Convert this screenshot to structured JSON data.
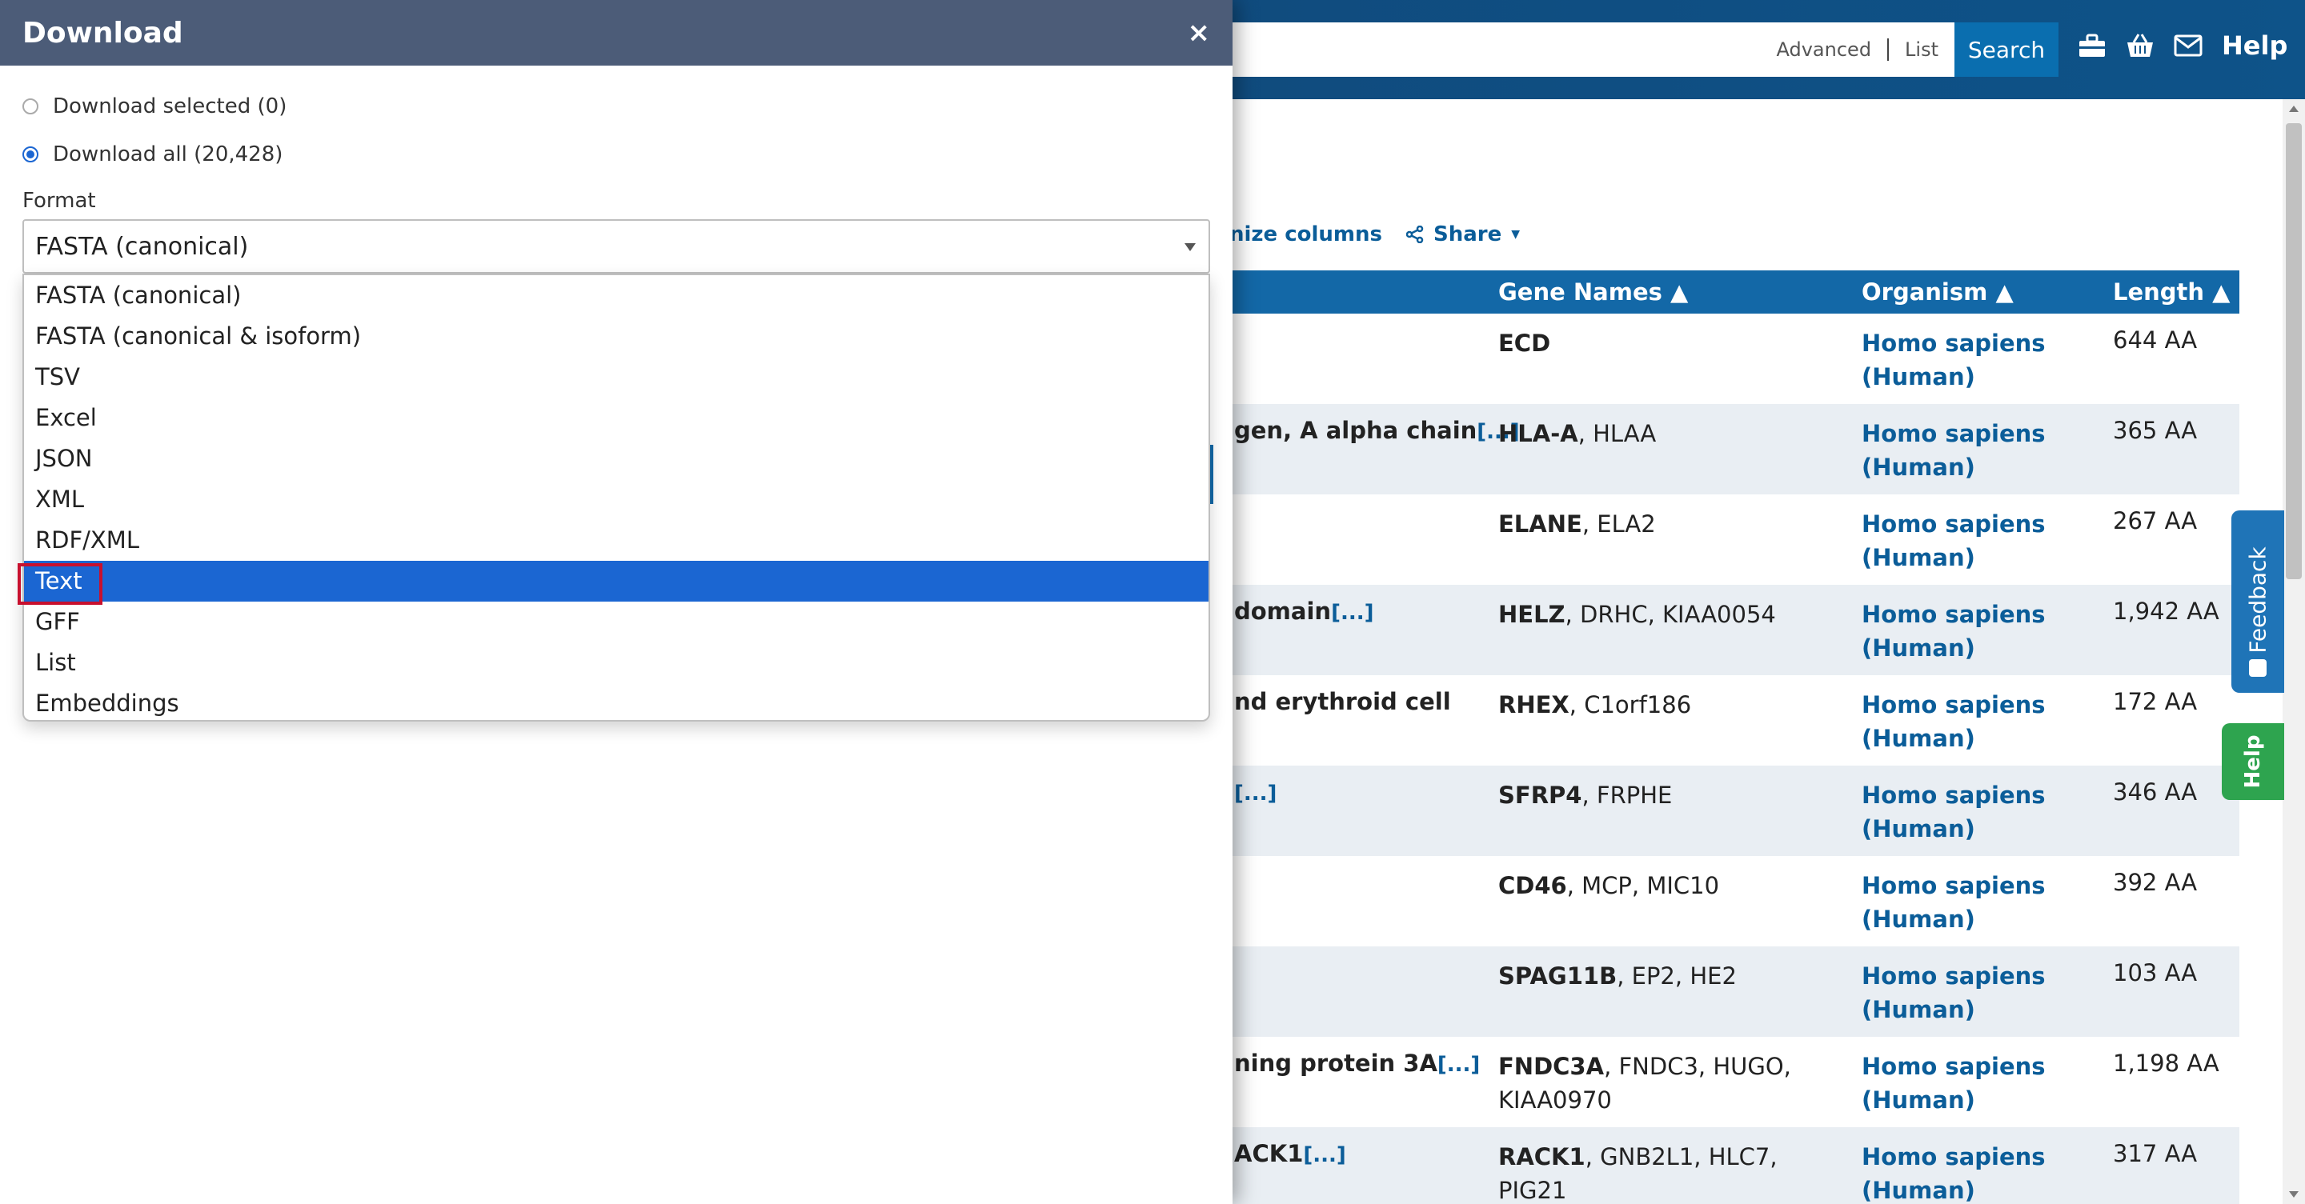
{
  "topbar": {
    "advanced_label": "Advanced",
    "list_label": "List",
    "search_label": "Search",
    "help_label": "Help",
    "icons": [
      "toolbox-icon",
      "basket-icon",
      "mail-icon"
    ]
  },
  "toolbar": {
    "customize_label": "nize columns",
    "share_label": "Share"
  },
  "table": {
    "headers": [
      "Gene Names ▲",
      "Organism ▲",
      "Length ▲"
    ],
    "rows": [
      {
        "protein": "",
        "more": "",
        "gene_bold": "ECD",
        "gene_rest": "",
        "organism": "Homo sapiens (Human)",
        "length": "644 AA"
      },
      {
        "protein": "gen, A alpha chain",
        "more": "[...]",
        "gene_bold": "HLA-A",
        "gene_rest": ", HLAA",
        "organism": "Homo sapiens (Human)",
        "length": "365 AA"
      },
      {
        "protein": "",
        "more": "",
        "gene_bold": "ELANE",
        "gene_rest": ", ELA2",
        "organism": "Homo sapiens (Human)",
        "length": "267 AA"
      },
      {
        "protein": "domain",
        "more": "[...]",
        "gene_bold": "HELZ",
        "gene_rest": ", DRHC, KIAA0054",
        "organism": "Homo sapiens (Human)",
        "length": "1,942 AA"
      },
      {
        "protein": "nd erythroid cell",
        "more": "",
        "gene_bold": "RHEX",
        "gene_rest": ", C1orf186",
        "organism": "Homo sapiens (Human)",
        "length": "172 AA"
      },
      {
        "protein": "",
        "more": "[...]",
        "gene_bold": "SFRP4",
        "gene_rest": ", FRPHE",
        "organism": "Homo sapiens (Human)",
        "length": "346 AA"
      },
      {
        "protein": "",
        "more": "",
        "gene_bold": "CD46",
        "gene_rest": ", MCP, MIC10",
        "organism": "Homo sapiens (Human)",
        "length": "392 AA"
      },
      {
        "protein": "",
        "more": "",
        "gene_bold": "SPAG11B",
        "gene_rest": ", EP2, HE2",
        "organism": "Homo sapiens (Human)",
        "length": "103 AA"
      },
      {
        "protein": "ning protein 3A",
        "more": "[...]",
        "gene_bold": "FNDC3A",
        "gene_rest": ", FNDC3, HUGO, KIAA0970",
        "organism": "Homo sapiens (Human)",
        "length": "1,198 AA"
      },
      {
        "protein": "ACK1",
        "more": "[...]",
        "gene_bold": "RACK1",
        "gene_rest": ", GNB2L1, HLC7, PIG21",
        "organism": "Homo sapiens (Human)",
        "length": "317 AA"
      }
    ]
  },
  "side_tabs": {
    "feedback_label": "Feedback",
    "help_label": "Help"
  },
  "modal": {
    "title": "Download",
    "close_label": "×",
    "radio_selected": "Download selected (0)",
    "radio_all": "Download all (20,428)",
    "format_label": "Format",
    "format_value": "FASTA (canonical)",
    "options": [
      "FASTA (canonical)",
      "FASTA (canonical & isoform)",
      "TSV",
      "Excel",
      "JSON",
      "XML",
      "RDF/XML",
      "Text",
      "GFF",
      "List",
      "Embeddings"
    ],
    "highlighted_option_index": 7
  },
  "colors": {
    "modal_header": "#4c5c78",
    "selected_option": "#1b66d2",
    "table_header": "#1368a7",
    "link": "#0b5d99",
    "highlight_border": "#c8102e"
  }
}
